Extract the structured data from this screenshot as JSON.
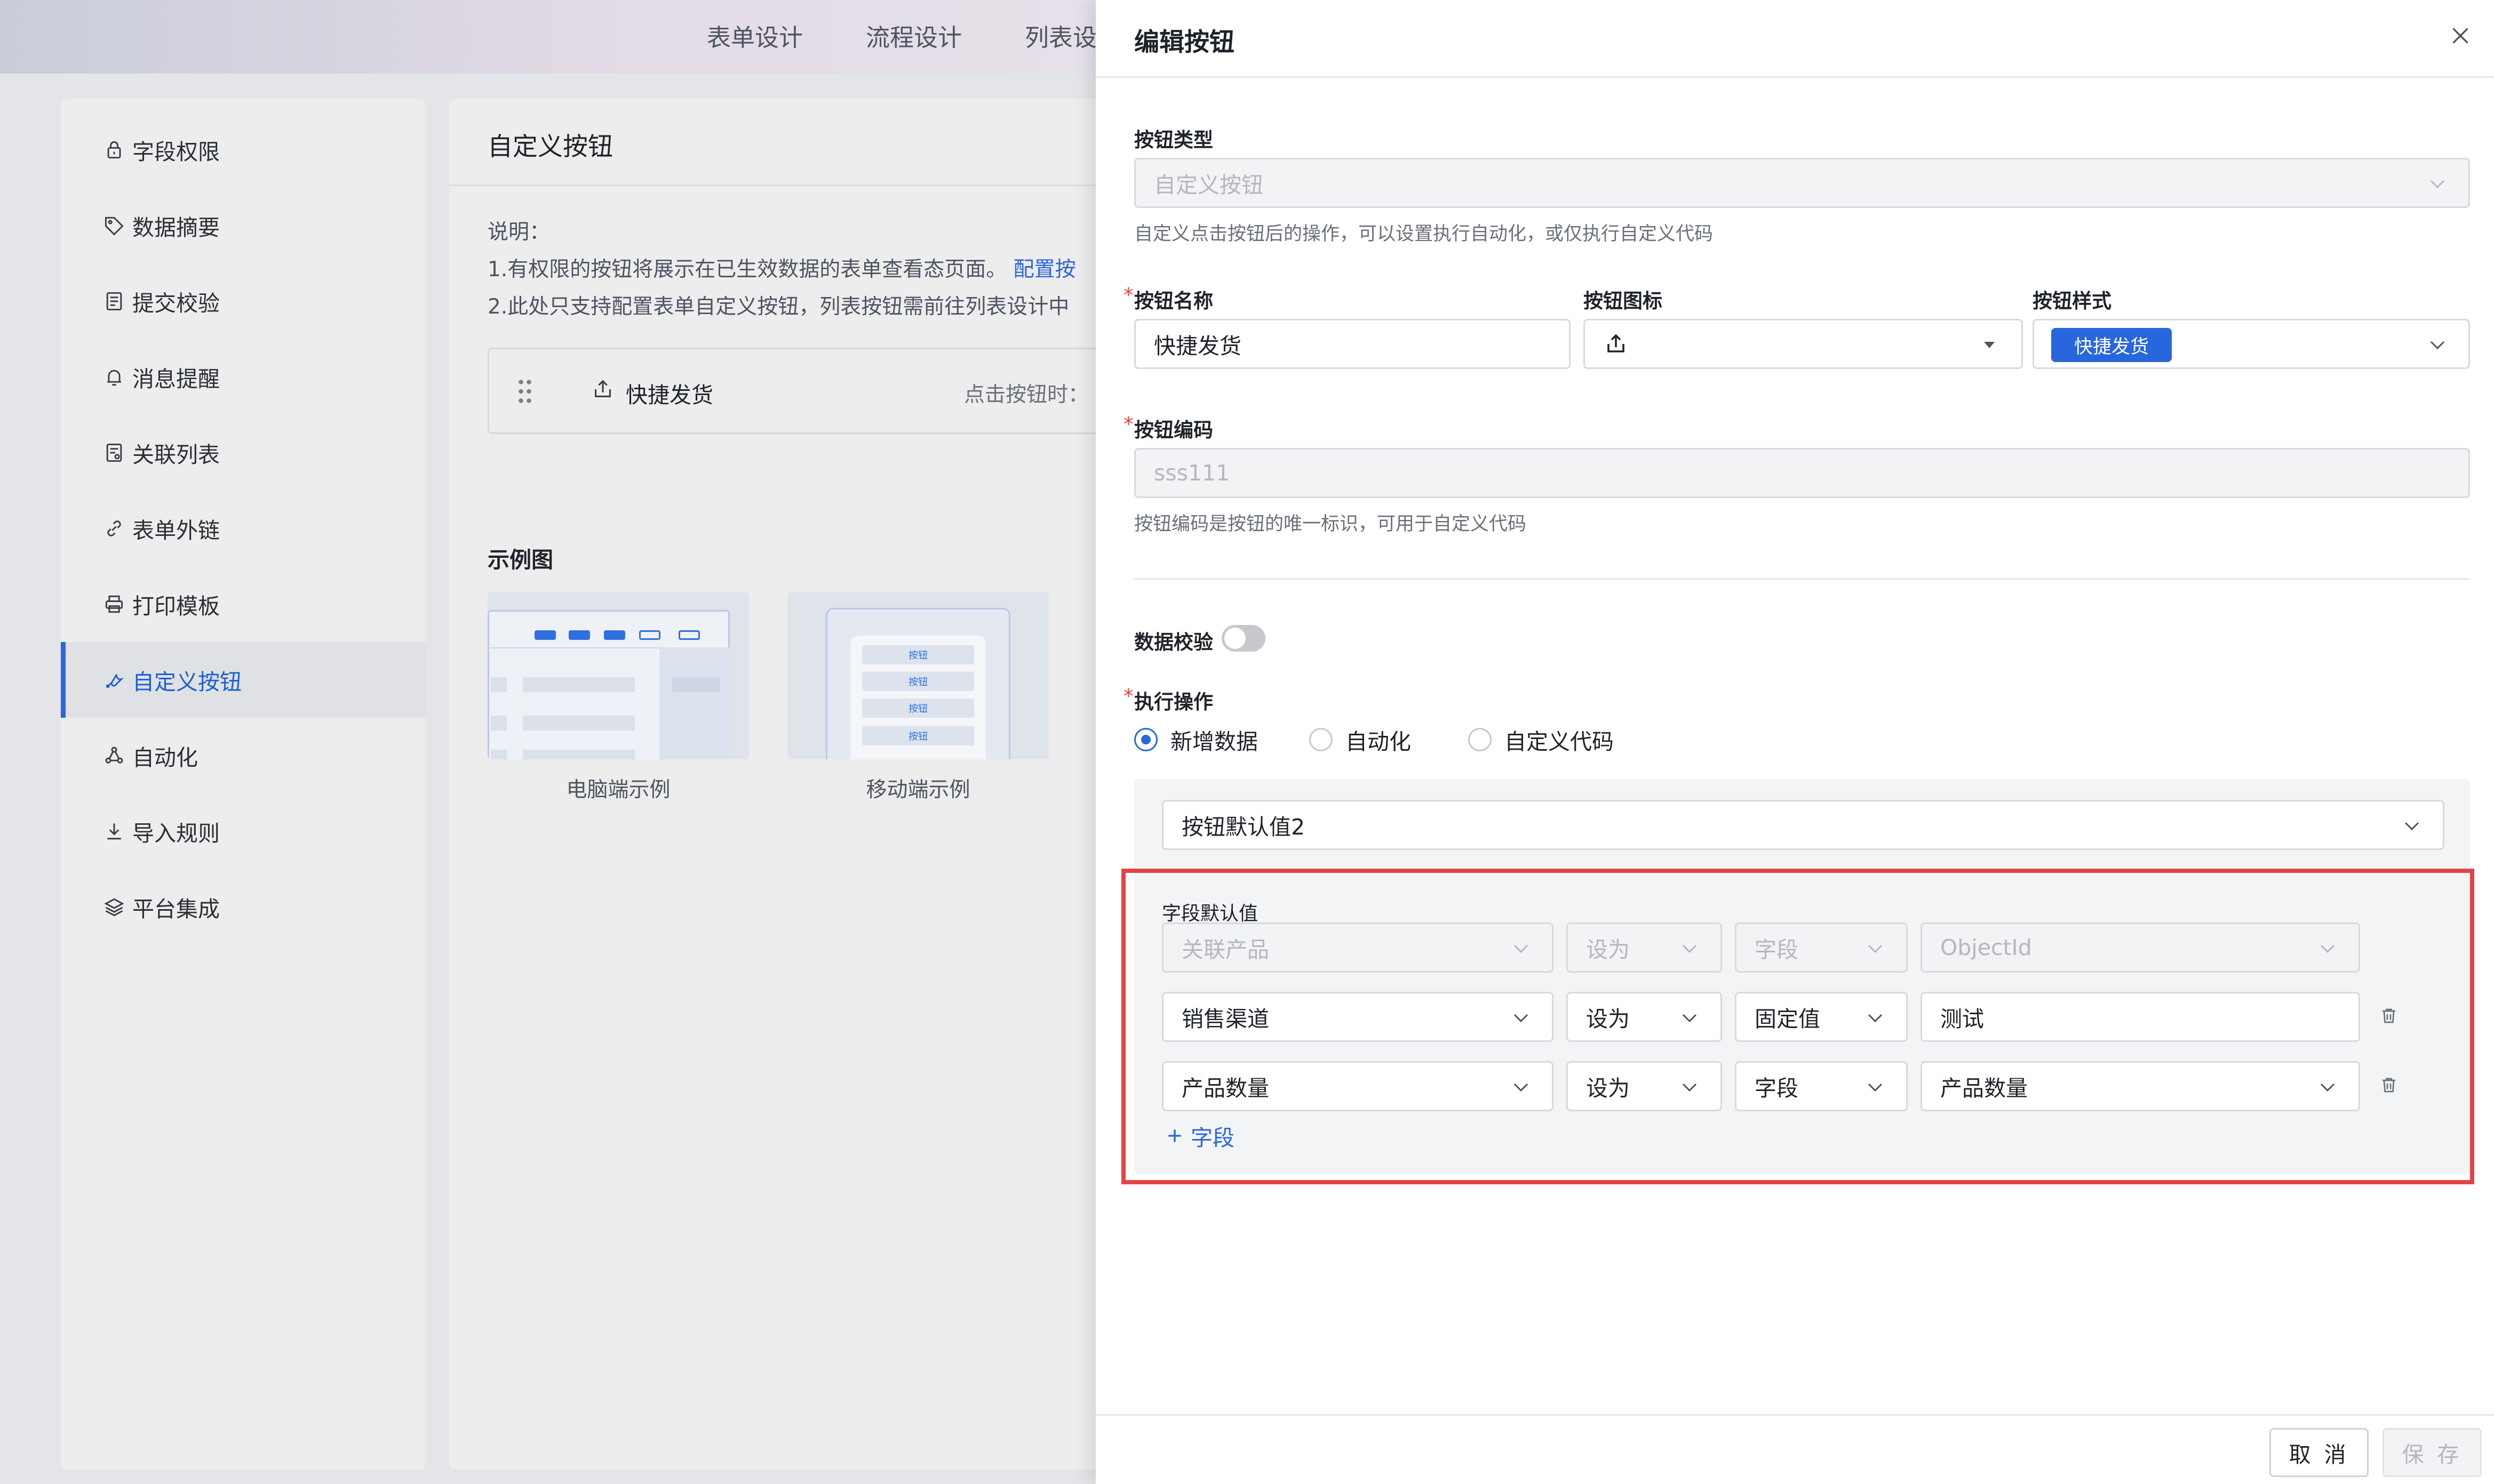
{
  "topnav": {
    "items": [
      "表单设计",
      "流程设计",
      "列表设"
    ]
  },
  "sidebar": {
    "items": [
      {
        "label": "字段权限",
        "icon": "lock-icon"
      },
      {
        "label": "数据摘要",
        "icon": "tag-icon"
      },
      {
        "label": "提交校验",
        "icon": "checklist-icon"
      },
      {
        "label": "消息提醒",
        "icon": "bell-icon"
      },
      {
        "label": "关联列表",
        "icon": "linked-list-icon"
      },
      {
        "label": "表单外链",
        "icon": "link-icon"
      },
      {
        "label": "打印模板",
        "icon": "printer-icon"
      },
      {
        "label": "自定义按钮",
        "icon": "wrench-icon",
        "active": true
      },
      {
        "label": "自动化",
        "icon": "automation-icon"
      },
      {
        "label": "导入规则",
        "icon": "download-icon"
      },
      {
        "label": "平台集成",
        "icon": "layers-icon"
      }
    ]
  },
  "main": {
    "title": "自定义按钮",
    "desc_heading": "说明：",
    "desc_line1": "1.有权限的按钮将展示在已生效数据的表单查看态页面。",
    "desc_link": "配置按",
    "desc_line2": "2.此处只支持配置表单自定义按钮，列表按钮需前往列表设计中",
    "button_name": "快捷发货",
    "button_click": "点击按钮时：",
    "examples_title": "示例图",
    "example_desktop": "电脑端示例",
    "example_mobile": "移动端示例",
    "mobile_btn": "按钮"
  },
  "drawer": {
    "title": "编辑按钮",
    "type_label": "按钮类型",
    "type_value": "自定义按钮",
    "type_hint": "自定义点击按钮后的操作，可以设置执行自动化，或仅执行自定义代码",
    "name_label": "按钮名称",
    "name_value": "快捷发货",
    "icon_label": "按钮图标",
    "style_label": "按钮样式",
    "style_value": "快捷发货",
    "code_label": "按钮编码",
    "code_value": "sss111",
    "code_hint": "按钮编码是按钮的唯一标识，可用于自定义代码",
    "validate_label": "数据校验",
    "validate_on": false,
    "action_label": "执行操作",
    "actions": [
      "新增数据",
      "自动化",
      "自定义代码"
    ],
    "action_selected": "新增数据",
    "default_select": "按钮默认值2",
    "defaults_label": "字段默认值",
    "rows": [
      {
        "field": "关联产品",
        "op": "设为",
        "type": "字段",
        "value": "ObjectId",
        "disabled": true
      },
      {
        "field": "销售渠道",
        "op": "设为",
        "type": "固定值",
        "value": "测试",
        "disabled": false
      },
      {
        "field": "产品数量",
        "op": "设为",
        "type": "字段",
        "value": "产品数量",
        "disabled": false
      }
    ],
    "add_field": "字段",
    "cancel": "取 消",
    "save": "保 存"
  },
  "colors": {
    "primary": "#2766dc",
    "highlight": "#e24346",
    "required": "#e5484d"
  }
}
